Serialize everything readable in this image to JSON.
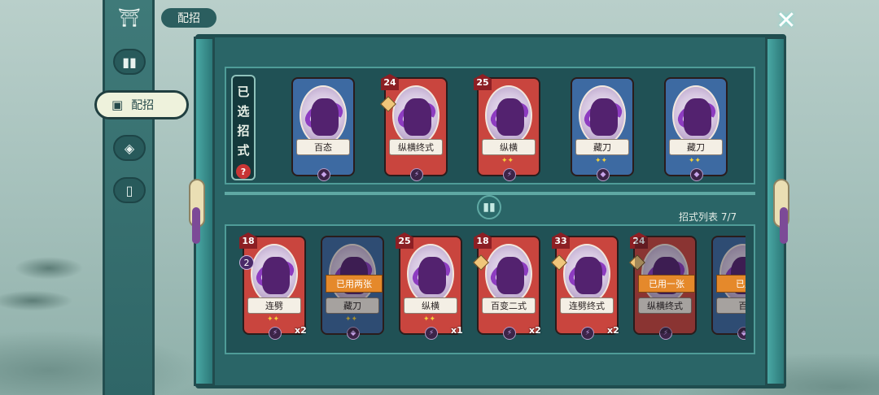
{
  "header": {
    "title": "配招"
  },
  "sidebar": {
    "items": [
      {
        "icon": "pavilion-icon",
        "glyph": "⛩"
      },
      {
        "icon": "cards-icon",
        "glyph": "▮▮"
      },
      {
        "icon": "deck-icon",
        "glyph": "▣",
        "label": "配招",
        "active": true
      },
      {
        "icon": "emblem-icon",
        "glyph": "◈"
      },
      {
        "icon": "card-single-icon",
        "glyph": "▯"
      }
    ]
  },
  "selected": {
    "label_chars": [
      "已",
      "选",
      "招",
      "式"
    ],
    "help_glyph": "?",
    "cards": [
      {
        "name": "百态",
        "color": "blue",
        "cost": "",
        "stars": "",
        "type_glyph": "◆"
      },
      {
        "name": "纵横终式",
        "color": "red",
        "cost": "24",
        "stars": "",
        "type_glyph": "⚡",
        "seal": true
      },
      {
        "name": "纵横",
        "color": "red",
        "cost": "25",
        "stars": "✦✦",
        "type_glyph": "⚡"
      },
      {
        "name": "藏刀",
        "color": "blue",
        "cost": "",
        "stars": "✦✦",
        "type_glyph": "◆"
      },
      {
        "name": "藏刀",
        "color": "blue",
        "cost": "",
        "stars": "✦✦",
        "type_glyph": "◆"
      }
    ]
  },
  "list": {
    "title": "招式列表",
    "count": "7/7",
    "cards": [
      {
        "name": "连劈",
        "color": "red",
        "cost": "18",
        "sub": "2",
        "stars": "✦✦",
        "type_glyph": "⚡",
        "mult": "x2",
        "used": ""
      },
      {
        "name": "藏刀",
        "color": "blue",
        "cost": "",
        "sub": "",
        "stars": "✦✦",
        "type_glyph": "◆",
        "mult": "",
        "used": "已用两张",
        "dim": true
      },
      {
        "name": "纵横",
        "color": "red",
        "cost": "25",
        "sub": "",
        "stars": "✦✦",
        "type_glyph": "⚡",
        "mult": "x1",
        "used": ""
      },
      {
        "name": "百变二式",
        "color": "red",
        "cost": "18",
        "sub": "",
        "stars": "",
        "type_glyph": "⚡",
        "mult": "x2",
        "used": "",
        "seal": true
      },
      {
        "name": "连劈终式",
        "color": "red",
        "cost": "33",
        "sub": "",
        "stars": "",
        "type_glyph": "⚡",
        "mult": "x2",
        "used": "",
        "seal": true
      },
      {
        "name": "纵横终式",
        "color": "red",
        "cost": "24",
        "sub": "",
        "stars": "",
        "type_glyph": "⚡",
        "mult": "",
        "used": "已用一张",
        "dim": true,
        "seal": true
      },
      {
        "name": "百",
        "color": "blue",
        "cost": "",
        "sub": "",
        "stars": "",
        "type_glyph": "◆",
        "mult": "",
        "used": "已用",
        "dim": true
      }
    ]
  },
  "controls": {
    "close_glyph": "✕",
    "divider_glyph": "▮▮"
  }
}
